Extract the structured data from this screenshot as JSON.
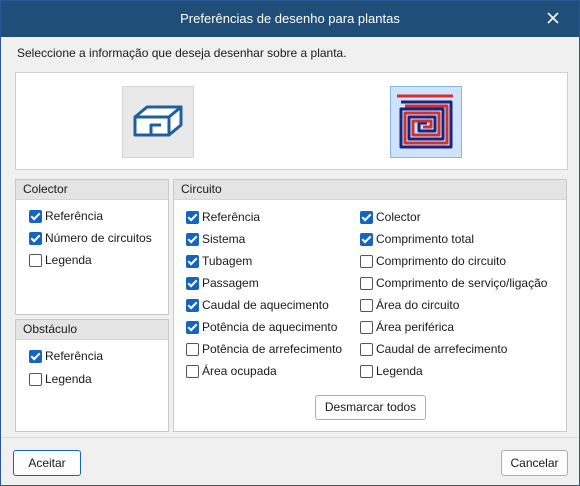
{
  "window": {
    "title": "Preferências de desenho para plantas"
  },
  "instruction": "Seleccione a informação que deseja desenhar sobre a planta.",
  "colector": {
    "title": "Colector",
    "items": [
      {
        "label": "Referência",
        "checked": true
      },
      {
        "label": "Número de circuitos",
        "checked": true
      },
      {
        "label": "Legenda",
        "checked": false
      }
    ]
  },
  "obstaculo": {
    "title": "Obstáculo",
    "items": [
      {
        "label": "Referência",
        "checked": true
      },
      {
        "label": "Legenda",
        "checked": false
      }
    ]
  },
  "circuito": {
    "title": "Circuito",
    "col1": [
      {
        "label": "Referência",
        "checked": true
      },
      {
        "label": "Sistema",
        "checked": true
      },
      {
        "label": "Tubagem",
        "checked": true
      },
      {
        "label": "Passagem",
        "checked": true
      },
      {
        "label": "Caudal de aquecimento",
        "checked": true
      },
      {
        "label": "Potência de aquecimento",
        "checked": true
      },
      {
        "label": "Potência de arrefecimento",
        "checked": false
      },
      {
        "label": "Área ocupada",
        "checked": false
      }
    ],
    "col2": [
      {
        "label": "Colector",
        "checked": true
      },
      {
        "label": "Comprimento total",
        "checked": true
      },
      {
        "label": "Comprimento do circuito",
        "checked": false
      },
      {
        "label": "Comprimento de serviço/ligação",
        "checked": false
      },
      {
        "label": "Área do circuito",
        "checked": false
      },
      {
        "label": "Área periférica",
        "checked": false
      },
      {
        "label": "Caudal de arrefecimento",
        "checked": false
      },
      {
        "label": "Legenda",
        "checked": false
      }
    ],
    "unmark_all_label": "Desmarcar todos"
  },
  "footer": {
    "accept_label": "Aceitar",
    "cancel_label": "Cancelar"
  },
  "icons": {
    "obstacle": "obstacle-block-icon",
    "circuit": "spiral-circuit-icon"
  },
  "colors": {
    "titlebar": "#1f4e79",
    "checkbox_checked": "#1565c0",
    "circuit_red": "#d32f2f",
    "circuit_blue": "#1a237e"
  }
}
